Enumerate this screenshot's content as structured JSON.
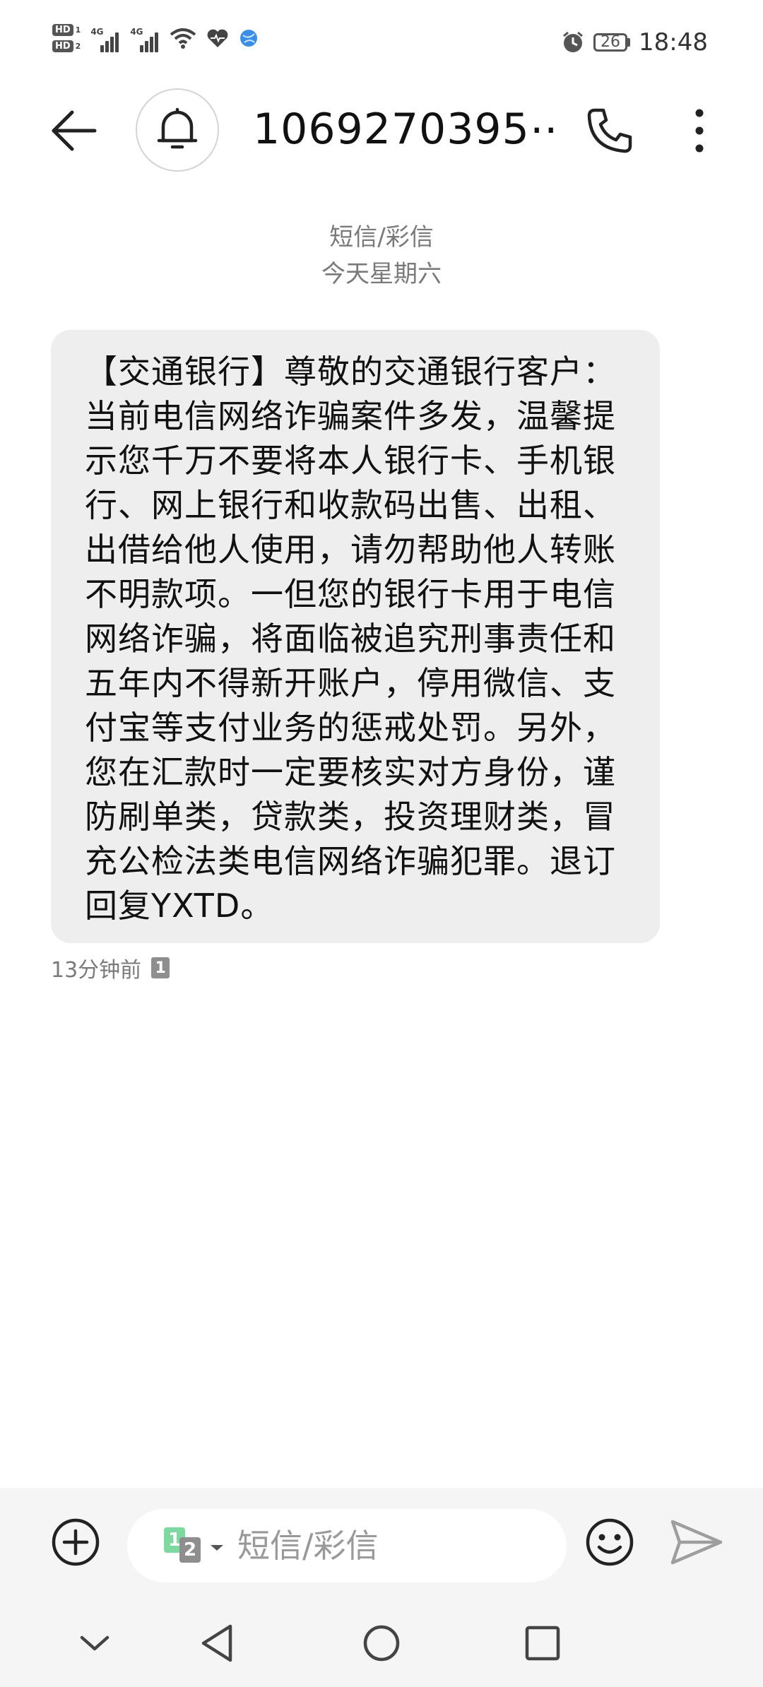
{
  "status_bar": {
    "sim1_label": "HD",
    "sim1_num": "1",
    "sim2_label": "HD",
    "sim2_num": "2",
    "network1": "4G",
    "network2": "4G",
    "battery_level": "26",
    "time": "18:48"
  },
  "header": {
    "contact_number": "1069270395⋯"
  },
  "conversation": {
    "channel_label": "短信/彩信",
    "date_label": "今天星期六"
  },
  "message": {
    "text": "【交通银行】尊敬的交通银行客户：当前电信网络诈骗案件多发，温馨提示您千万不要将本人银行卡、手机银行、网上银行和收款码出售、出租、出借给他人使用，请勿帮助他人转账不明款项。一但您的银行卡用于电信网络诈骗，将面临被追究刑事责任和五年内不得新开账户，停用微信、支付宝等支付业务的惩戒处罚。另外，您在汇款时一定要核实对方身份，谨防刷单类，贷款类，投资理财类，冒充公检法类电信网络诈骗犯罪。退订回复YXTD。",
    "time": "13分钟前",
    "sim_badge": "1"
  },
  "composer": {
    "sim1": "1",
    "sim2": "2",
    "placeholder": "短信/彩信"
  },
  "icons": {
    "back": "arrow-left-icon",
    "bell": "bell-icon",
    "call": "phone-icon",
    "more": "more-vertical-icon",
    "add": "plus-circle-icon",
    "emoji": "smiley-icon",
    "send": "send-icon"
  }
}
